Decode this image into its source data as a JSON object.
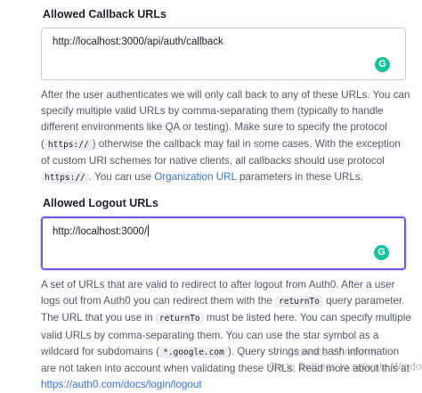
{
  "callback": {
    "label": "Allowed Callback URLs",
    "value": "http://localhost:3000/api/auth/callback",
    "help": {
      "t1": "After the user authenticates we will only call back to any of these URLs. You can specify multiple valid URLs by comma-separating them (typically to handle different environments like QA or testing). Make sure to specify the protocol (",
      "code1": "https://",
      "t2": ") otherwise the callback may fail in some cases. With the exception of custom URI schemes for native clients, all callbacks should use protocol",
      "code2": "https://",
      "t3": ". You can use",
      "link": "Organization URL",
      "t4": "parameters in these URLs."
    }
  },
  "logout": {
    "label": "Allowed Logout URLs",
    "value": "http://localhost:3000/",
    "help": {
      "t1": "A set of URLs that are valid to redirect to after logout from Auth0. After a user logs out from Auth0 you can redirect them with the",
      "code1": "returnTo",
      "t2": "query parameter. The URL that you use in",
      "code2": "returnTo",
      "t3": "must be listed here. You can specify multiple valid URLs by comma-separating them. You can use the star symbol as a wildcard for subdomains (",
      "code3": "*.google.com",
      "t4": "). Query strings and hash information are not taken into account when validating these URLs. Read more about this at",
      "link": "https://auth0.com/docs/login/logout"
    }
  },
  "grammarly": {
    "glyph": "G"
  },
  "watermark": {
    "line1": "Activate Windows",
    "line2": "Go to Settings to activate Windows."
  },
  "colors": {
    "focus": "#6b5fe0",
    "link": "#3b6fd4",
    "grammarly": "#15c39a"
  }
}
